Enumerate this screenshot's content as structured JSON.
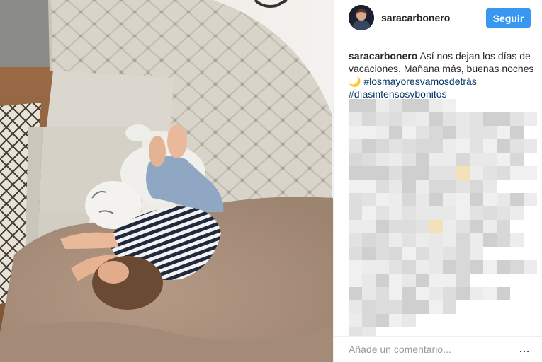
{
  "post": {
    "author": {
      "username": "saracarbonero",
      "follow_label": "Seguir"
    },
    "caption": {
      "username": "saracarbonero",
      "text": "Así nos dejan los días de vacaciones. Mañana más, buenas noches",
      "moon_emoji": "🌙",
      "hashtags": [
        "#losmayoresvamosdetrás",
        "#díasintensosybonitos"
      ]
    },
    "comment_box": {
      "placeholder": "Añade un comentario...",
      "more_label": "..."
    }
  },
  "icons": {
    "avatar": "profile-avatar",
    "more": "ellipsis-icon"
  },
  "colors": {
    "follow_button": "#3897f0",
    "hashtag": "#003569",
    "username": "#262626",
    "placeholder": "#999999",
    "divider": "#efefef"
  }
}
